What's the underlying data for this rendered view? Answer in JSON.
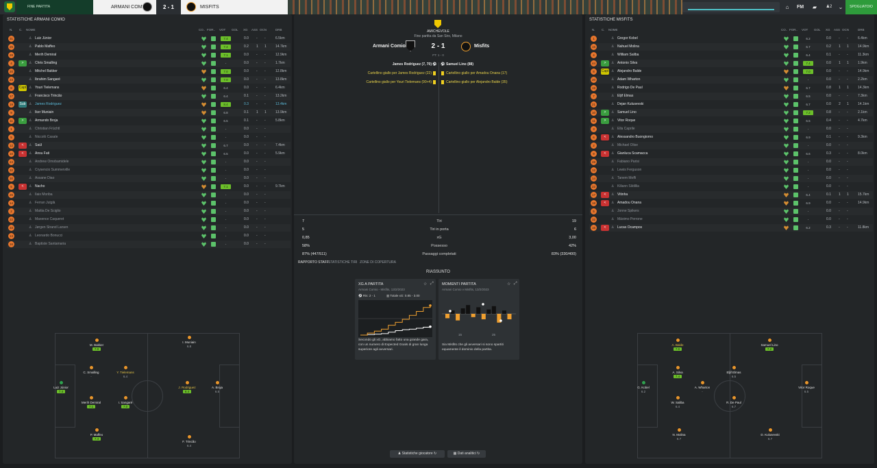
{
  "topbar": {
    "stage": "FINE PARTITA",
    "home_team": "ARMANI COMIO",
    "score": "2 - 1",
    "away_team": "MISFITS",
    "fm_label": "FM",
    "notifications": "2",
    "continue_label": "SPOGLIATOIO",
    "match_progress": 1.0
  },
  "left_panel": {
    "title": "STATISTICHE ARMANI COMIO",
    "headers": {
      "name": "NOME",
      "co": "CO..",
      "form": "FOR..",
      "vote": "VOT",
      "goals": "GOL",
      "xg": "XG",
      "ast": "ASS",
      "ocn": "OCN",
      "dist": "DRB"
    },
    "players": [
      {
        "n": "31",
        "sub": "",
        "name": "Luiz Júnior",
        "vote": "7.4",
        "vg": true,
        "xg": "0.0",
        "ast": "-",
        "ocn": "-",
        "dist": "6.5km",
        "hc": "g"
      },
      {
        "n": "25",
        "sub": "",
        "name": "Pablo Maffeo",
        "vote": "7.4",
        "vg": true,
        "xg": "0.2",
        "ast": "1",
        "ocn": "1",
        "dist": "14.7km",
        "hc": "g"
      },
      {
        "n": "28",
        "sub": "",
        "name": "Merih Demiral",
        "vote": "7.1",
        "vg": true,
        "xg": "0.0",
        "ast": "-",
        "ocn": "-",
        "dist": "12.9km",
        "hc": "g"
      },
      {
        "n": "4",
        "sub": ">",
        "sc": "in",
        "name": "Chris Smalling",
        "vote": "-",
        "vg": false,
        "xg": "0.0",
        "ast": "-",
        "ocn": "-",
        "dist": "1.7km",
        "hc": "g"
      },
      {
        "n": "20",
        "sub": "",
        "name": "Mitchel Bakker",
        "vote": "7.0",
        "vg": true,
        "xg": "0.0",
        "ast": "-",
        "ocn": "-",
        "dist": "12.8km",
        "hc": "o"
      },
      {
        "n": "23",
        "sub": "",
        "name": "Ibrahim Sangaré",
        "vote": "7.0",
        "vg": true,
        "xg": "0.0",
        "ast": "-",
        "ocn": "-",
        "dist": "13.8km",
        "hc": "g"
      },
      {
        "n": "8",
        "sub": "Capt",
        "sc": "cap",
        "name": "Youri Tielemans",
        "vote": "6.4",
        "vg": false,
        "xg": "0.0",
        "ast": "-",
        "ocn": "-",
        "dist": "6.4km",
        "hc": "o"
      },
      {
        "n": "17",
        "sub": "",
        "name": "Francisco Trincão",
        "vote": "6.4",
        "vg": false,
        "xg": "0.1",
        "ast": "-",
        "ocn": "-",
        "dist": "13.2km",
        "hc": "g"
      },
      {
        "n": "19",
        "sub": "Sub",
        "sc": "sub1",
        "name": "James Rodriguez",
        "vote": "8.4",
        "vg": true,
        "xg": "0.3",
        "ast": "-",
        "ocn": "-",
        "dist": "13.4km",
        "hc": "o",
        "link": true
      },
      {
        "n": "9",
        "sub": "",
        "name": "Iker Muniain",
        "vote": "6.8",
        "vg": false,
        "xg": "0.1",
        "ast": "1",
        "ocn": "1",
        "dist": "13.9km",
        "hc": "o"
      },
      {
        "n": "11",
        "sub": ">",
        "sc": "in",
        "name": "Armando Broja",
        "vote": "6.5",
        "vg": false,
        "xg": "0.1",
        "ast": "-",
        "ocn": "-",
        "dist": "5.8km",
        "hc": "g"
      },
      {
        "n": "1",
        "sub": "",
        "name": "Christian Früchtl",
        "vote": "-",
        "vg": false,
        "xg": "0.0",
        "ast": "-",
        "ocn": "-",
        "dist": "",
        "hc": "g",
        "dim": true
      },
      {
        "n": "5",
        "sub": "",
        "name": "Niccolò Casale",
        "vote": "-",
        "vg": false,
        "xg": "0.0",
        "ast": "-",
        "ocn": "-",
        "dist": "",
        "hc": "g",
        "dim": true
      },
      {
        "n": "12",
        "sub": "<",
        "sc": "out",
        "name": "Saúl",
        "vote": "6.7",
        "vg": false,
        "xg": "0.0",
        "ast": "-",
        "ocn": "-",
        "dist": "7.4km",
        "hc": "g"
      },
      {
        "n": "10",
        "sub": "<",
        "sc": "out",
        "name": "Ansu Fati",
        "vote": "6.5",
        "vg": false,
        "xg": "0.0",
        "ast": "-",
        "ocn": "-",
        "dist": "5.9km",
        "hc": "g"
      },
      {
        "n": "24",
        "sub": "",
        "name": "Andrew Omobamidele",
        "vote": "-",
        "vg": false,
        "xg": "0.0",
        "ast": "-",
        "ocn": "-",
        "dist": "",
        "hc": "g",
        "dim": true
      },
      {
        "n": "32",
        "sub": "",
        "name": "Crysencio Summerville",
        "vote": "-",
        "vg": false,
        "xg": "0.0",
        "ast": "-",
        "ocn": "-",
        "dist": "",
        "hc": "g",
        "dim": true
      },
      {
        "n": "30",
        "sub": "",
        "name": "Assane Diao",
        "vote": "-",
        "vg": false,
        "xg": "0.0",
        "ast": "-",
        "ocn": "-",
        "dist": "",
        "hc": "g",
        "dim": true
      },
      {
        "n": "5",
        "sub": "<",
        "sc": "out",
        "name": "Nacho",
        "vote": "7.1",
        "vg": true,
        "xg": "0.0",
        "ast": "-",
        "ocn": "-",
        "dist": "9.7km",
        "hc": "o"
      },
      {
        "n": "26",
        "sub": "",
        "name": "Ilaix Moriba",
        "vote": "-",
        "vg": false,
        "xg": "0.0",
        "ast": "-",
        "ocn": "-",
        "dist": "",
        "hc": "g",
        "dim": true
      },
      {
        "n": "14",
        "sub": "",
        "name": "Ferran Jutglà",
        "vote": "-",
        "vg": false,
        "xg": "0.0",
        "ast": "-",
        "ocn": "-",
        "dist": "",
        "hc": "g",
        "dim": true
      },
      {
        "n": "2",
        "sub": "",
        "name": "Mattia De Sciglio",
        "vote": "-",
        "vg": false,
        "xg": "0.0",
        "ast": "-",
        "ocn": "-",
        "dist": "",
        "hc": "g",
        "dim": true
      },
      {
        "n": "22",
        "sub": "",
        "name": "Maxence Caqueret",
        "vote": "-",
        "vg": false,
        "xg": "0.0",
        "ast": "-",
        "ocn": "-",
        "dist": "",
        "hc": "g",
        "dim": true
      },
      {
        "n": "33",
        "sub": "",
        "name": "Jørgen Strand Larsen",
        "vote": "-",
        "vg": false,
        "xg": "0.0",
        "ast": "-",
        "ocn": "-",
        "dist": "",
        "hc": "g",
        "dim": true
      },
      {
        "n": "13",
        "sub": "",
        "name": "Leonardo Bonucci",
        "vote": "-",
        "vg": false,
        "xg": "0.0",
        "ast": "-",
        "ocn": "-",
        "dist": "",
        "hc": "g",
        "dim": true
      },
      {
        "n": "16",
        "sub": "",
        "name": "Baptiste Santamaria",
        "vote": "-",
        "vg": false,
        "xg": "0.0",
        "ast": "-",
        "ocn": "-",
        "dist": "",
        "hc": "g",
        "dim": true
      }
    ],
    "lineup": [
      {
        "name": "M. Bakker",
        "rating": "7.0",
        "green": true
      },
      {
        "name": "I. Muniain",
        "rating": "6.8",
        "green": false
      },
      {
        "name": "C. Smalling",
        "rating": "-",
        "green": false
      },
      {
        "name": "Y. Tielemans",
        "rating": "6.4",
        "green": false,
        "gold": true
      },
      {
        "name": "Luiz Júnior",
        "rating": "7.4",
        "green": true,
        "gk": true
      },
      {
        "name": "J. Rodriguez",
        "rating": "8.4",
        "green": true,
        "gold": true
      },
      {
        "name": "A. Broja",
        "rating": "6.5",
        "green": false
      },
      {
        "name": "Merih Demiral",
        "rating": "7.1",
        "green": true
      },
      {
        "name": "I. Sangaré",
        "rating": "7.0",
        "green": true
      },
      {
        "name": "P. Maffeo",
        "rating": "7.4",
        "green": true
      },
      {
        "name": "F. Trincão",
        "rating": "6.4",
        "green": false
      }
    ]
  },
  "right_panel": {
    "title": "STATISTICHE MISFITS",
    "players": [
      {
        "n": "1",
        "sub": "",
        "name": "Gregor Kobel",
        "vote": "6.2",
        "vg": false,
        "xg": "0.0",
        "ast": "-",
        "ocn": "-",
        "dist": "6.4km",
        "hc": "g"
      },
      {
        "n": "15",
        "sub": "",
        "name": "Nahuel Molina",
        "vote": "6.7",
        "vg": false,
        "xg": "0.2",
        "ast": "1",
        "ocn": "1",
        "dist": "14.9km",
        "hc": "g"
      },
      {
        "n": "4",
        "sub": "",
        "name": "William Saliba",
        "vote": "6.4",
        "vg": false,
        "xg": "0.1",
        "ast": "-",
        "ocn": "-",
        "dist": "11.3km",
        "hc": "g"
      },
      {
        "n": "44",
        "sub": ">",
        "sc": "in",
        "name": "Antonio Silva",
        "vote": "7.4",
        "vg": true,
        "xg": "0.0",
        "ast": "1",
        "ocn": "1",
        "dist": "1.9km",
        "hc": "g"
      },
      {
        "n": "8",
        "sub": "Capt",
        "sc": "cap",
        "name": "Alejandro Balde",
        "vote": "7.0",
        "vg": true,
        "xg": "0.0",
        "ast": "-",
        "ocn": "-",
        "dist": "14.9km",
        "hc": "o"
      },
      {
        "n": "20",
        "sub": "",
        "name": "Adam Wharton",
        "vote": "-",
        "vg": false,
        "xg": "0.0",
        "ast": "-",
        "ocn": "-",
        "dist": "2.2km",
        "hc": "g"
      },
      {
        "n": "19",
        "sub": "",
        "name": "Rodrigo De Paul",
        "vote": "6.7",
        "vg": false,
        "xg": "0.8",
        "ast": "1",
        "ocn": "1",
        "dist": "14.3km",
        "hc": "o"
      },
      {
        "n": "7",
        "sub": "",
        "name": "Eljif Elmas",
        "vote": "6.5",
        "vg": false,
        "xg": "0.0",
        "ast": "-",
        "ocn": "-",
        "dist": "7.3km",
        "hc": "g"
      },
      {
        "n": "21",
        "sub": "",
        "name": "Dejan Kulusevski",
        "vote": "6.7",
        "vg": false,
        "xg": "0.0",
        "ast": "2",
        "ocn": "1",
        "dist": "14.1km",
        "hc": "g"
      },
      {
        "n": "10",
        "sub": ">",
        "sc": "in",
        "name": "Samuel Lino",
        "vote": "7.2",
        "vg": true,
        "xg": "0.8",
        "ast": "-",
        "ocn": "-",
        "dist": "2.1km",
        "hc": "g"
      },
      {
        "n": "11",
        "sub": ">",
        "sc": "in",
        "name": "Vitor Roque",
        "vote": "6.5",
        "vg": false,
        "xg": "0.4",
        "ast": "-",
        "ocn": "-",
        "dist": "4.7km",
        "hc": "g"
      },
      {
        "n": "3",
        "sub": "",
        "name": "Ella Caprile",
        "vote": "-",
        "vg": false,
        "xg": "0.0",
        "ast": "-",
        "ocn": "-",
        "dist": "",
        "hc": "g",
        "dim": true
      },
      {
        "n": "6",
        "sub": "<",
        "sc": "out",
        "name": "Alessandro Buongiorno",
        "vote": "6.9",
        "vg": false,
        "xg": "0.1",
        "ast": "-",
        "ocn": "-",
        "dist": "9.3km",
        "hc": "g"
      },
      {
        "n": "2",
        "sub": "",
        "name": "Michael Olise",
        "vote": "-",
        "vg": false,
        "xg": "0.0",
        "ast": "-",
        "ocn": "-",
        "dist": "",
        "hc": "g",
        "dim": true
      },
      {
        "n": "9",
        "sub": "<",
        "sc": "out",
        "name": "Gianluca Scamacca",
        "vote": "6.6",
        "vg": false,
        "xg": "0.3",
        "ast": "-",
        "ocn": "-",
        "dist": "8.0km",
        "hc": "g"
      },
      {
        "n": "28",
        "sub": "",
        "name": "Fabiano Parisi",
        "vote": "-",
        "vg": false,
        "xg": "0.0",
        "ast": "-",
        "ocn": "-",
        "dist": "",
        "hc": "g",
        "dim": true
      },
      {
        "n": "12",
        "sub": "",
        "name": "Lewis Ferguson",
        "vote": "-",
        "vg": false,
        "xg": "0.0",
        "ast": "-",
        "ocn": "-",
        "dist": "",
        "hc": "g",
        "dim": true
      },
      {
        "n": "14",
        "sub": "",
        "name": "Tanem Moffi",
        "vote": "-",
        "vg": false,
        "xg": "0.0",
        "ast": "-",
        "ocn": "-",
        "dist": "",
        "hc": "g",
        "dim": true
      },
      {
        "n": "22",
        "sub": "",
        "name": "Kiliann Sildillia",
        "vote": "-",
        "vg": false,
        "xg": "0.0",
        "ast": "-",
        "ocn": "-",
        "dist": "",
        "hc": "g",
        "dim": true
      },
      {
        "n": "17",
        "sub": "<",
        "sc": "out",
        "name": "Vitinha",
        "vote": "6.4",
        "vg": false,
        "xg": "0.1",
        "ast": "1",
        "ocn": "1",
        "dist": "15.7km",
        "hc": "o"
      },
      {
        "n": "18",
        "sub": "<",
        "sc": "out",
        "name": "Amadou Onana",
        "vote": "6.9",
        "vg": false,
        "xg": "0.0",
        "ast": "-",
        "ocn": "-",
        "dist": "14.9km",
        "hc": "o"
      },
      {
        "n": "5",
        "sub": "",
        "name": "Jonne Spikers",
        "vote": "-",
        "vg": false,
        "xg": "0.0",
        "ast": "-",
        "ocn": "-",
        "dist": "",
        "hc": "g",
        "dim": true
      },
      {
        "n": "32",
        "sub": "",
        "name": "Máximo Perrone",
        "vote": "-",
        "vg": false,
        "xg": "0.0",
        "ast": "-",
        "ocn": "-",
        "dist": "",
        "hc": "g",
        "dim": true
      },
      {
        "n": "16",
        "sub": "<",
        "sc": "out",
        "name": "Lucas Ocampos",
        "vote": "6.2",
        "vg": false,
        "xg": "0.3",
        "ast": "-",
        "ocn": "-",
        "dist": "11.8km",
        "hc": "o"
      }
    ],
    "lineup": [
      {
        "name": "A. Balde",
        "rating": "7.0",
        "green": true,
        "gold": true
      },
      {
        "name": "Samuel Lino",
        "rating": "7.2",
        "green": true
      },
      {
        "name": "A. Silva",
        "rating": "7.4",
        "green": true
      },
      {
        "name": "Eljif Elmas",
        "rating": "6.5",
        "green": false
      },
      {
        "name": "G. Kobel",
        "rating": "6.2",
        "green": false,
        "gk": true
      },
      {
        "name": "A. Wharton",
        "rating": "-",
        "green": false
      },
      {
        "name": "Vitor Roque",
        "rating": "6.5",
        "green": false
      },
      {
        "name": "W. Saliba",
        "rating": "6.4",
        "green": false
      },
      {
        "name": "R. De Paul",
        "rating": "6.7",
        "green": false
      },
      {
        "name": "N. Molina",
        "rating": "6.7",
        "green": false
      },
      {
        "name": "D. Kulusevski",
        "rating": "6.7",
        "green": false
      }
    ]
  },
  "match": {
    "competition": "AMICHEVOLE",
    "venue_line": "Fine partita da San Siro, Milano",
    "home": "Armani Comio",
    "away": "Misfits",
    "score": "2 - 1",
    "half_time": "PT: 1 - 0",
    "events_home": [
      "James Rodriguez (7, 70)",
      "Cartellino giallo per James Rodriguez (22)",
      "Cartellino giallo per Youri Tielemans (90+4)"
    ],
    "events_away": [
      "Samuel Lino (88)",
      "Cartellino giallo per Amadou Onana (17)",
      "Cartellino giallo per Alejandro Balde (35)"
    ],
    "stats": [
      {
        "label": "Tiri",
        "home": "7",
        "away": "19"
      },
      {
        "label": "Tiri in porta",
        "home": "5",
        "away": "6"
      },
      {
        "label": "xG",
        "home": "0,85",
        "away": "3,00"
      },
      {
        "label": "Possesso",
        "home": "58%",
        "away": "42%"
      },
      {
        "label": "Passaggi completati",
        "home": "87% (447/511)",
        "away": "83% (330/400)"
      }
    ],
    "tabs": [
      "RAPPORTO STAFF",
      "STATISTICHE",
      "TIRI",
      "ZONE DI COPERTURA"
    ],
    "summary_title": "RIASSUNTO",
    "xg_card": {
      "title": "XG A PARTITA",
      "subtitle": "Armani Comio - Misfits, 13/2/2023",
      "result": "Ris: 2 - 1",
      "total": "Totale xG: 0.85 - 3.00",
      "text": "Secondo gli xG, abbiamo fatto una grande gara, con un numero di Expected Goals di gran lunga superiore agli avversari."
    },
    "moments_card": {
      "title": "MOMENTI PARTITA",
      "subtitle": "Armani Comio v Misfits, 13/2/2023",
      "tick1": "15",
      "tick2": "25",
      "text": "Sia Misfits che gli avversari si sono spartiti equamente il dominio della partita."
    },
    "buttons": {
      "player_stats": "Statistiche giocatore",
      "analytics": "Dati analitici"
    }
  },
  "colors": {
    "accent": "#6cbf2a",
    "orange": "#e8762c",
    "background": "#1b1d1f"
  },
  "chart_data": [
    {
      "type": "line",
      "title": "XG A PARTITA",
      "series": [
        {
          "values": [
            0.0,
            0.05,
            0.1,
            0.15,
            0.3,
            0.45,
            0.55,
            0.6,
            0.7,
            0.8,
            0.85
          ]
        },
        {
          "values": [
            0.0,
            0.2,
            0.4,
            0.6,
            1.0,
            1.3,
            1.6,
            2.0,
            2.4,
            2.8,
            3.0
          ]
        }
      ]
    },
    {
      "type": "bar",
      "title": "MOMENTI PARTITA",
      "values": [
        -0.4,
        0.3,
        -0.6,
        0.5,
        0.8,
        -0.3,
        0.6,
        -0.5,
        0.4,
        0.7,
        -0.8,
        0.3,
        -0.5
      ]
    }
  ]
}
